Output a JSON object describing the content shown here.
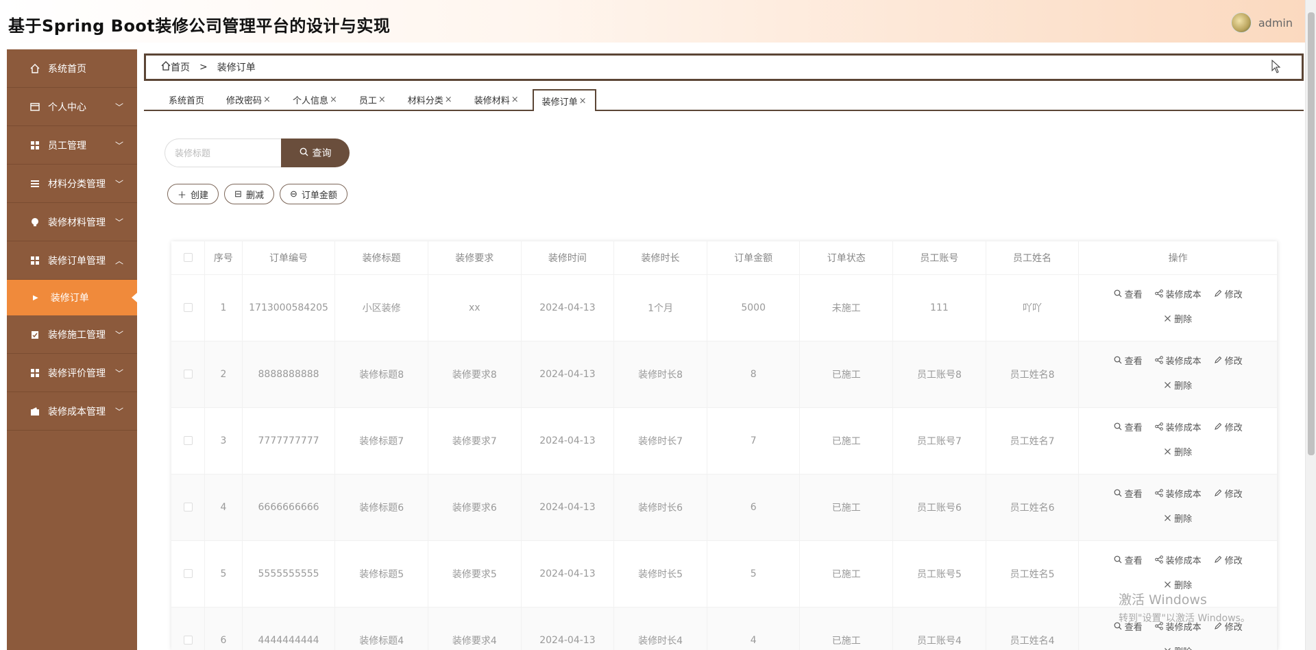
{
  "header": {
    "title": "基于Spring Boot装修公司管理平台的设计与实现",
    "username": "admin"
  },
  "sidebar": {
    "items": [
      {
        "label": "系统首页",
        "icon": "home-icon"
      },
      {
        "label": "个人中心",
        "icon": "wallet-icon"
      },
      {
        "label": "员工管理",
        "icon": "grid-icon"
      },
      {
        "label": "材料分类管理",
        "icon": "list-icon"
      },
      {
        "label": "装修材料管理",
        "icon": "bulb-icon"
      },
      {
        "label": "装修订单管理",
        "icon": "grid-icon"
      },
      {
        "label": "装修订单",
        "icon": "caret-right-icon"
      },
      {
        "label": "装修施工管理",
        "icon": "clipboard-icon"
      },
      {
        "label": "装修评价管理",
        "icon": "grid-icon"
      },
      {
        "label": "装修成本管理",
        "icon": "wallet-icon"
      }
    ]
  },
  "breadcrumb": {
    "home": "首页",
    "separator": ">",
    "current": "装修订单"
  },
  "tabs": [
    {
      "label": "系统首页",
      "closable": false
    },
    {
      "label": "修改密码",
      "closable": true
    },
    {
      "label": "个人信息",
      "closable": true
    },
    {
      "label": "员工",
      "closable": true
    },
    {
      "label": "材料分类",
      "closable": true
    },
    {
      "label": "装修材料",
      "closable": true
    },
    {
      "label": "装修订单",
      "closable": true
    }
  ],
  "search": {
    "placeholder": "装修标题",
    "button_label": "查询"
  },
  "actions": {
    "create": "创建",
    "delete": "删减",
    "amount": "订单金额"
  },
  "table": {
    "headers": [
      "序号",
      "订单编号",
      "装修标题",
      "装修要求",
      "装修时间",
      "装修时长",
      "订单金额",
      "订单状态",
      "员工账号",
      "员工姓名",
      "操作"
    ],
    "ops": {
      "view": "查看",
      "cost": "装修成本",
      "edit": "修改",
      "remove": "删除"
    },
    "rows": [
      [
        "1",
        "1713000584205",
        "小区装修",
        "xx",
        "2024-04-13",
        "1个月",
        "5000",
        "未施工",
        "111",
        "吖吖"
      ],
      [
        "2",
        "8888888888",
        "装修标题8",
        "装修要求8",
        "2024-04-13",
        "装修时长8",
        "8",
        "已施工",
        "员工账号8",
        "员工姓名8"
      ],
      [
        "3",
        "7777777777",
        "装修标题7",
        "装修要求7",
        "2024-04-13",
        "装修时长7",
        "7",
        "已施工",
        "员工账号7",
        "员工姓名7"
      ],
      [
        "4",
        "6666666666",
        "装修标题6",
        "装修要求6",
        "2024-04-13",
        "装修时长6",
        "6",
        "已施工",
        "员工账号6",
        "员工姓名6"
      ],
      [
        "5",
        "5555555555",
        "装修标题5",
        "装修要求5",
        "2024-04-13",
        "装修时长5",
        "5",
        "已施工",
        "员工账号5",
        "员工姓名5"
      ],
      [
        "6",
        "4444444444",
        "装修标题4",
        "装修要求4",
        "2024-04-13",
        "装修时长4",
        "4",
        "已施工",
        "员工账号4",
        "员工姓名4"
      ]
    ]
  },
  "watermark": {
    "line1": "激活 Windows",
    "line2": "转到\"设置\"以激活 Windows。"
  }
}
